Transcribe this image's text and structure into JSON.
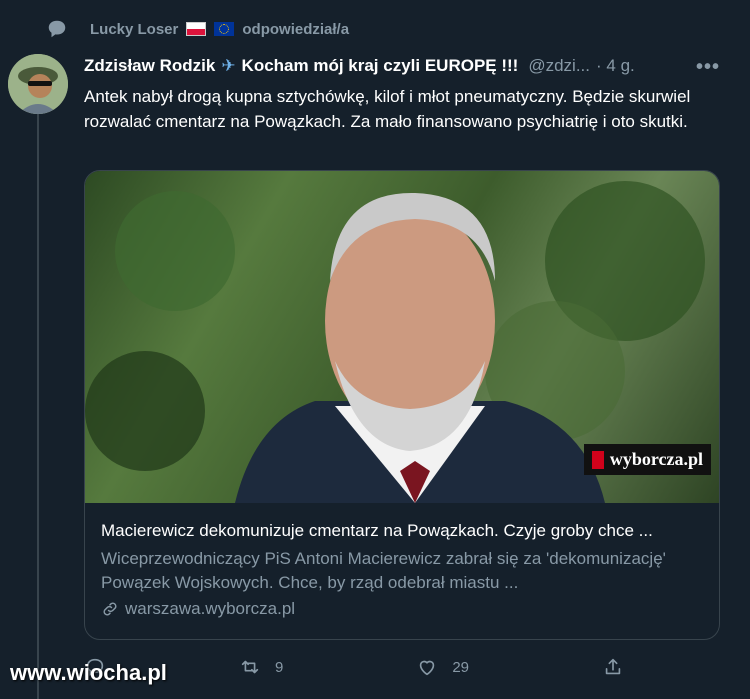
{
  "retweet": {
    "user": "Lucky Loser",
    "action": "odpowiedział/a"
  },
  "tweet": {
    "display_name": "Zdzisław Rodzik",
    "name_suffix": "Kocham mój kraj czyli EUROPĘ !!!",
    "handle": "@zdzi...",
    "time": "· 4 g.",
    "more": "•••",
    "text": "Antek nabył drogą kupna sztychówkę, kilof i młot pneumatyczny. Będzie skurwiel rozwalać cmentarz na Powązkach. Za mało finansowano psychiatrię i oto skutki."
  },
  "card": {
    "watermark": "wyborcza.pl",
    "title": "Macierewicz dekomunizuje cmentarz na Powązkach. Czyje groby chce ...",
    "description": "Wiceprzewodniczący PiS Antoni Macierewicz zabrał się za 'dekomunizację' Powązek Wojskowych. Chce, by rząd odebrał miastu ...",
    "domain": "warszawa.wyborcza.pl"
  },
  "actions": {
    "retweets": "9",
    "likes": "29"
  },
  "site_watermark": "www.wiocha.pl"
}
